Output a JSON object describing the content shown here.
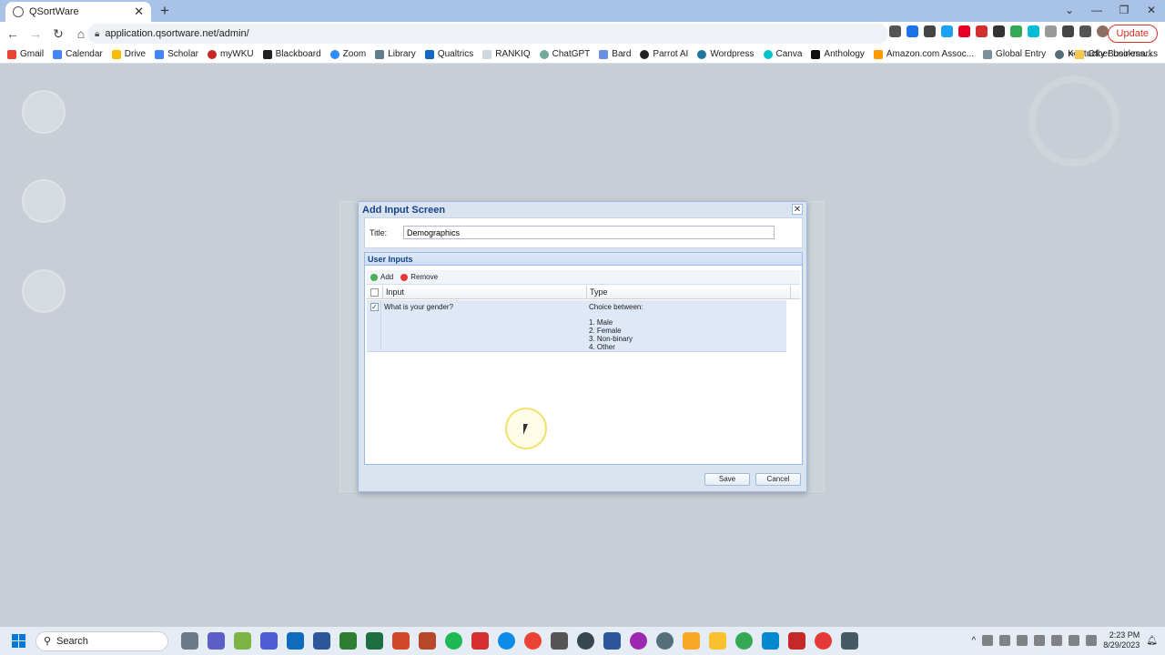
{
  "browser": {
    "tab_title": "QSortWare",
    "url": "application.qsortware.net/admin/",
    "update_label": "Update",
    "bookmarks": [
      "Gmail",
      "Calendar",
      "Drive",
      "Scholar",
      "myWKU",
      "Blackboard",
      "Zoom",
      "Library",
      "Qualtrics",
      "RANKIQ",
      "ChatGPT",
      "Bard",
      "Parrot AI",
      "Wordpress",
      "Canva",
      "Anthology",
      "Amazon.com Assoc...",
      "Global Entry",
      "Kentucky Business..."
    ],
    "other_bookmarks": "Other bookmarks"
  },
  "dialog": {
    "title": "Add Input Screen",
    "title_label": "Title:",
    "title_value": "Demographics",
    "panel_title": "User Inputs",
    "add_label": "Add",
    "remove_label": "Remove",
    "columns": {
      "input": "Input",
      "type": "Type"
    },
    "rows": [
      {
        "input": "What is your gender?",
        "type_header": "Choice between:",
        "options": [
          "1. Male",
          "2. Female",
          "3. Non-binary",
          "4. Other"
        ],
        "checked": true
      }
    ],
    "save_label": "Save",
    "cancel_label": "Cancel"
  },
  "taskbar": {
    "search_label": "Search",
    "time": "2:23 PM",
    "date": "8/29/2023"
  },
  "colors": {
    "dialog_header_text": "#15428b",
    "panel_border": "#99bbe8",
    "selected_row": "#dfe8f6",
    "update_button": "#d93025"
  }
}
